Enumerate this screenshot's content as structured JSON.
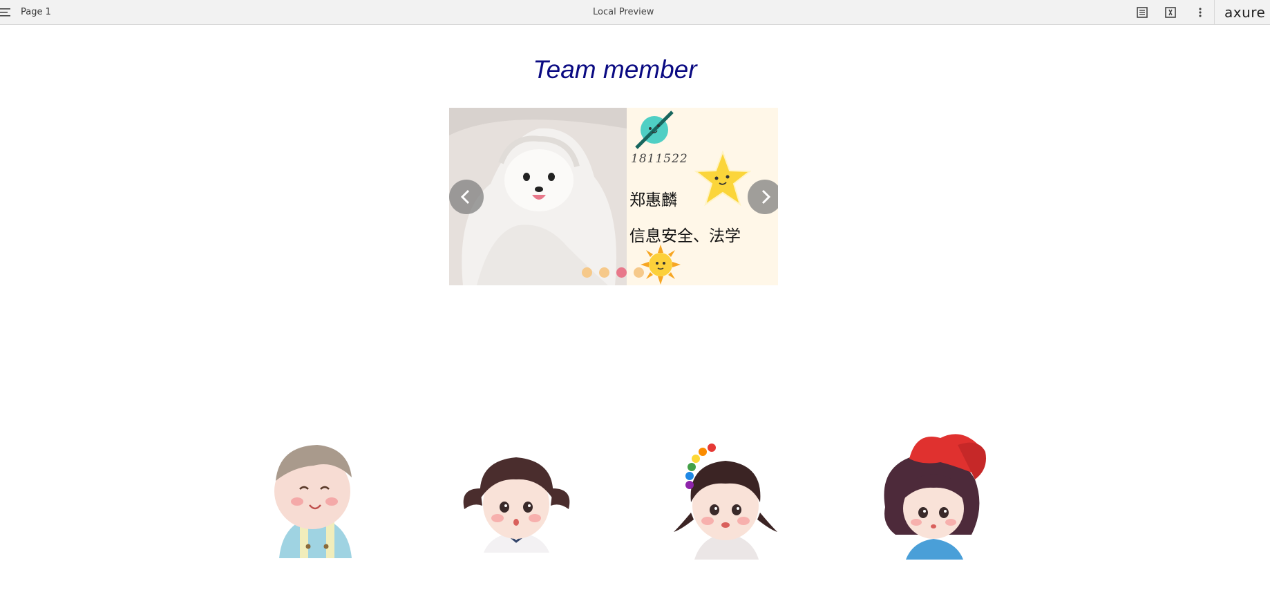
{
  "toolbar": {
    "page_name": "Page 1",
    "title": "Local Preview",
    "brand": "axure"
  },
  "heading": "Team member",
  "carousel": {
    "student_id": "1811522",
    "name": "郑惠麟",
    "major": "信息安全、法学",
    "dot_count": 4,
    "active_dot_index": 2
  },
  "colors": {
    "heading": "#0a0a82",
    "card_background": "#fff7e8",
    "dot": "#f6c98a",
    "dot_active": "#e8788a",
    "nav_button": "#808080"
  },
  "icons": [
    "menu-icon",
    "notes-icon",
    "inspect-icon",
    "more-icon",
    "chevron-left-icon",
    "chevron-right-icon",
    "planet-icon",
    "star-icon",
    "sun-icon"
  ]
}
